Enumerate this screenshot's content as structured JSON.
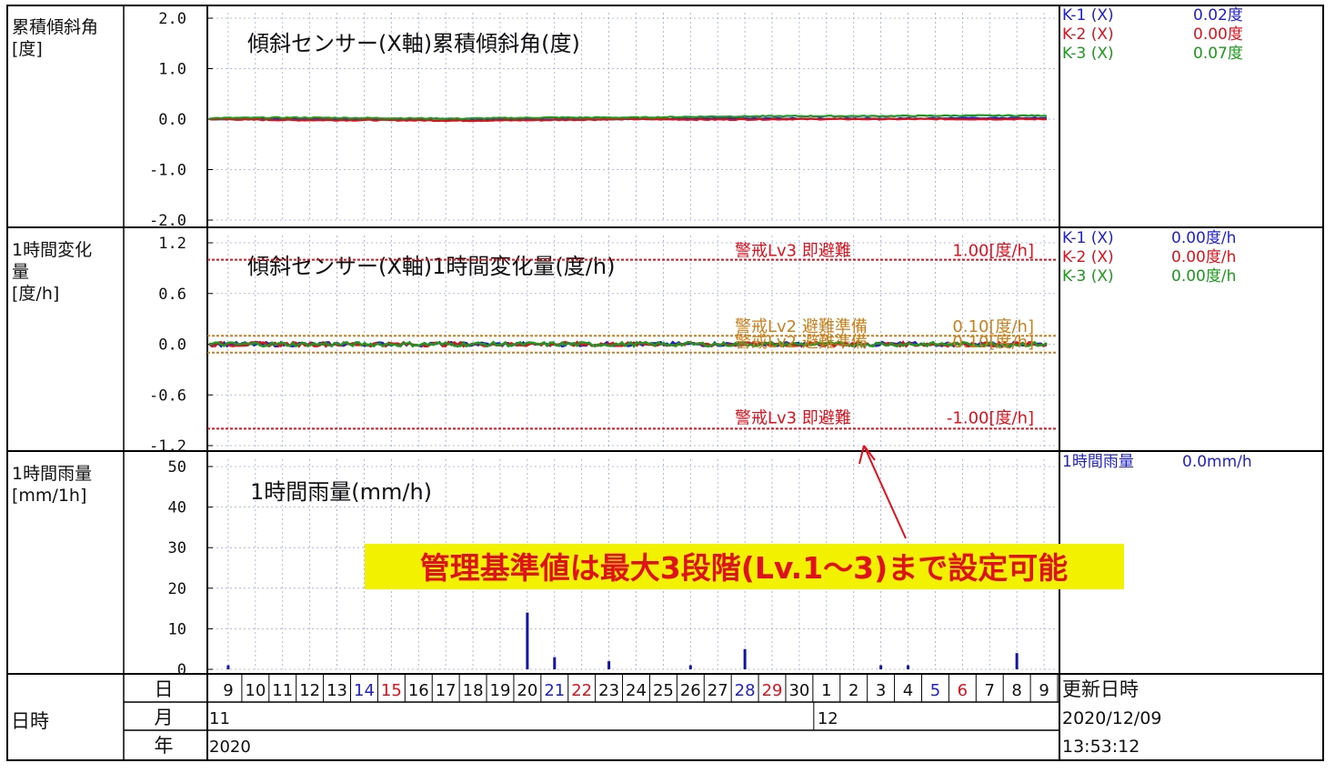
{
  "colors": {
    "k1": "#1f1fd0",
    "k2": "#e0101c",
    "k3": "#1a9a1a",
    "rain": "#1414a0",
    "lv3": "#e0101c",
    "lv2": "#c8801a",
    "grid": "#9aa6e0",
    "frame": "#000000",
    "note_bg": "#f2f200",
    "note_text": "#e0101c",
    "arrow": "#e0101c"
  },
  "panels": [
    {
      "id": "tilt",
      "ylabel": "累積傾斜角\n[度]",
      "title": "傾斜センサー(X軸)累積傾斜角(度)",
      "yticks": [
        "2.0",
        "1.0",
        "0.0",
        "-1.0",
        "-2.0"
      ],
      "legend": [
        {
          "name": "K-1 (X)",
          "value": "0.02度",
          "color": "k1"
        },
        {
          "name": "K-2 (X)",
          "value": "0.00度",
          "color": "k2"
        },
        {
          "name": "K-3 (X)",
          "value": "0.07度",
          "color": "k3"
        }
      ]
    },
    {
      "id": "change",
      "ylabel": "1時間変化\n量\n[度/h]",
      "title": "傾斜センサー(X軸)1時間変化量(度/h)",
      "yticks": [
        "1.2",
        "0.6",
        "0.0",
        "-0.6",
        "-1.2"
      ],
      "legend": [
        {
          "name": "K-1 (X)",
          "value": "0.00度/h",
          "color": "k1"
        },
        {
          "name": "K-2 (X)",
          "value": "0.00度/h",
          "color": "k2"
        },
        {
          "name": "K-3 (X)",
          "value": "0.00度/h",
          "color": "k3"
        }
      ],
      "thresholds": [
        {
          "label": "警戒Lv3 即避難",
          "value_label": "1.00[度/h]",
          "value": 1.0,
          "color": "lv3"
        },
        {
          "label": "警戒Lv2 避難準備",
          "value_label": "0.10[度/h]",
          "value": 0.1,
          "color": "lv2"
        },
        {
          "label": "警戒Lv2 避難準備",
          "value_label": "-0.10[度/h]",
          "value": -0.1,
          "color": "lv2"
        },
        {
          "label": "警戒Lv3 即避難",
          "value_label": "-1.00[度/h]",
          "value": -1.0,
          "color": "lv3"
        }
      ]
    },
    {
      "id": "rain",
      "ylabel": "1時間雨量\n[mm/1h]",
      "title": "1時間雨量(mm/h)",
      "yticks": [
        "50",
        "40",
        "30",
        "20",
        "10",
        "0"
      ],
      "legend": [
        {
          "name": "1時間雨量",
          "value": "0.0mm/h",
          "color": "k1"
        }
      ]
    }
  ],
  "annotation": "管理基準値は最大3段階(Lv.1～3)まで設定可能",
  "footer": {
    "row_label": "日時",
    "day_label": "日",
    "month_label": "月",
    "year_label": "年",
    "days": [
      "9",
      "10",
      "11",
      "12",
      "13",
      "14",
      "15",
      "16",
      "17",
      "18",
      "19",
      "20",
      "21",
      "22",
      "23",
      "24",
      "25",
      "26",
      "27",
      "28",
      "29",
      "30",
      "1",
      "2",
      "3",
      "4",
      "5",
      "6",
      "7",
      "8",
      "9"
    ],
    "day_colors": [
      "",
      "",
      "",
      "",
      "",
      "k1",
      "k2",
      "",
      "",
      "",
      "",
      "",
      "k1",
      "k2",
      "",
      "",
      "",
      "",
      "",
      "k1",
      "k2",
      "",
      "",
      "",
      "",
      "",
      "k1",
      "k2",
      "",
      "",
      ""
    ],
    "months": [
      "11",
      "12"
    ],
    "year": "2020",
    "updated_label": "更新日時",
    "updated_date": "2020/12/09",
    "updated_time": "13:53:12"
  },
  "chart_data": [
    {
      "type": "line",
      "title": "傾斜センサー(X軸)累積傾斜角(度)",
      "ylabel": "累積傾斜角 [度]",
      "ylim": [
        -2.0,
        2.0
      ],
      "x": [
        "2020-11-09",
        "2020-11-12",
        "2020-11-15",
        "2020-11-18",
        "2020-11-21",
        "2020-11-24",
        "2020-11-27",
        "2020-11-30",
        "2020-12-03",
        "2020-12-06",
        "2020-12-09"
      ],
      "series": [
        {
          "name": "K-1 (X)",
          "values": [
            0.0,
            0.0,
            0.0,
            0.0,
            0.0,
            0.0,
            0.01,
            0.01,
            0.01,
            0.02,
            0.02
          ]
        },
        {
          "name": "K-2 (X)",
          "values": [
            0.0,
            -0.02,
            -0.02,
            -0.03,
            -0.02,
            0.0,
            -0.01,
            0.0,
            0.0,
            0.0,
            0.0
          ]
        },
        {
          "name": "K-3 (X)",
          "values": [
            0.02,
            0.03,
            0.02,
            0.01,
            0.03,
            0.03,
            0.05,
            0.06,
            0.06,
            0.07,
            0.07
          ]
        }
      ]
    },
    {
      "type": "line",
      "title": "傾斜センサー(X軸)1時間変化量(度/h)",
      "ylabel": "1時間変化量 [度/h]",
      "ylim": [
        -1.2,
        1.2
      ],
      "x": [
        "2020-11-09",
        "2020-11-12",
        "2020-11-15",
        "2020-11-18",
        "2020-11-21",
        "2020-11-24",
        "2020-11-27",
        "2020-11-30",
        "2020-12-03",
        "2020-12-06",
        "2020-12-09"
      ],
      "series": [
        {
          "name": "K-1 (X)",
          "values": [
            0,
            0,
            0,
            0,
            0,
            0,
            0,
            0,
            0,
            0,
            0
          ]
        },
        {
          "name": "K-2 (X)",
          "values": [
            0,
            0,
            0,
            0,
            0,
            0,
            0,
            0,
            0,
            0,
            0
          ]
        },
        {
          "name": "K-3 (X)",
          "values": [
            0,
            0,
            0,
            0,
            0,
            0,
            0,
            0,
            0,
            0,
            0
          ]
        }
      ]
    },
    {
      "type": "bar",
      "title": "1時間雨量(mm/h)",
      "ylabel": "1時間雨量 [mm/1h]",
      "ylim": [
        0,
        50
      ],
      "x": [
        "2020-11-09",
        "2020-11-20",
        "2020-11-21",
        "2020-11-23",
        "2020-11-26",
        "2020-11-28",
        "2020-12-03",
        "2020-12-04",
        "2020-12-08"
      ],
      "series": [
        {
          "name": "1時間雨量",
          "values": [
            1,
            14,
            3,
            2,
            1,
            5,
            1,
            1,
            4
          ]
        }
      ]
    }
  ]
}
